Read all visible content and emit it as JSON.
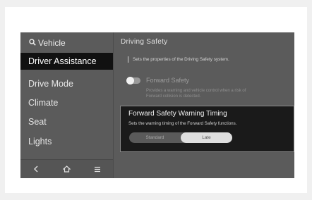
{
  "search": {
    "icon": "search-icon",
    "label": "Vehicle"
  },
  "sidebar": {
    "items": [
      {
        "label": "Driver Assistance",
        "active": true
      },
      {
        "label": "Drive Mode",
        "active": false
      },
      {
        "label": "Climate",
        "active": false
      },
      {
        "label": "Seat",
        "active": false
      },
      {
        "label": "Lights",
        "active": false
      }
    ],
    "bottom_icons": [
      "back-icon",
      "home-icon",
      "menu-icon"
    ]
  },
  "main": {
    "title": "Driving Safety",
    "description": "Sets the properties of the Driving Safety system.",
    "forward_safety": {
      "label": "Forward Safety",
      "enabled": false,
      "description_line1": "Provides a warning and vehicle control when a risk of",
      "description_line2": "Forward collision is detected."
    }
  },
  "popup": {
    "title": "Forward Safety Warning Timing",
    "description": "Sets the warning timing of the Forward Safety functions.",
    "options": [
      "Standard",
      "Late"
    ],
    "selected": "Late"
  },
  "colors": {
    "screen_bg": "#5b5b5b",
    "active_item_bg": "#111111",
    "popup_bg": "#1a1a1a",
    "selected_option_bg": "#dedede"
  }
}
